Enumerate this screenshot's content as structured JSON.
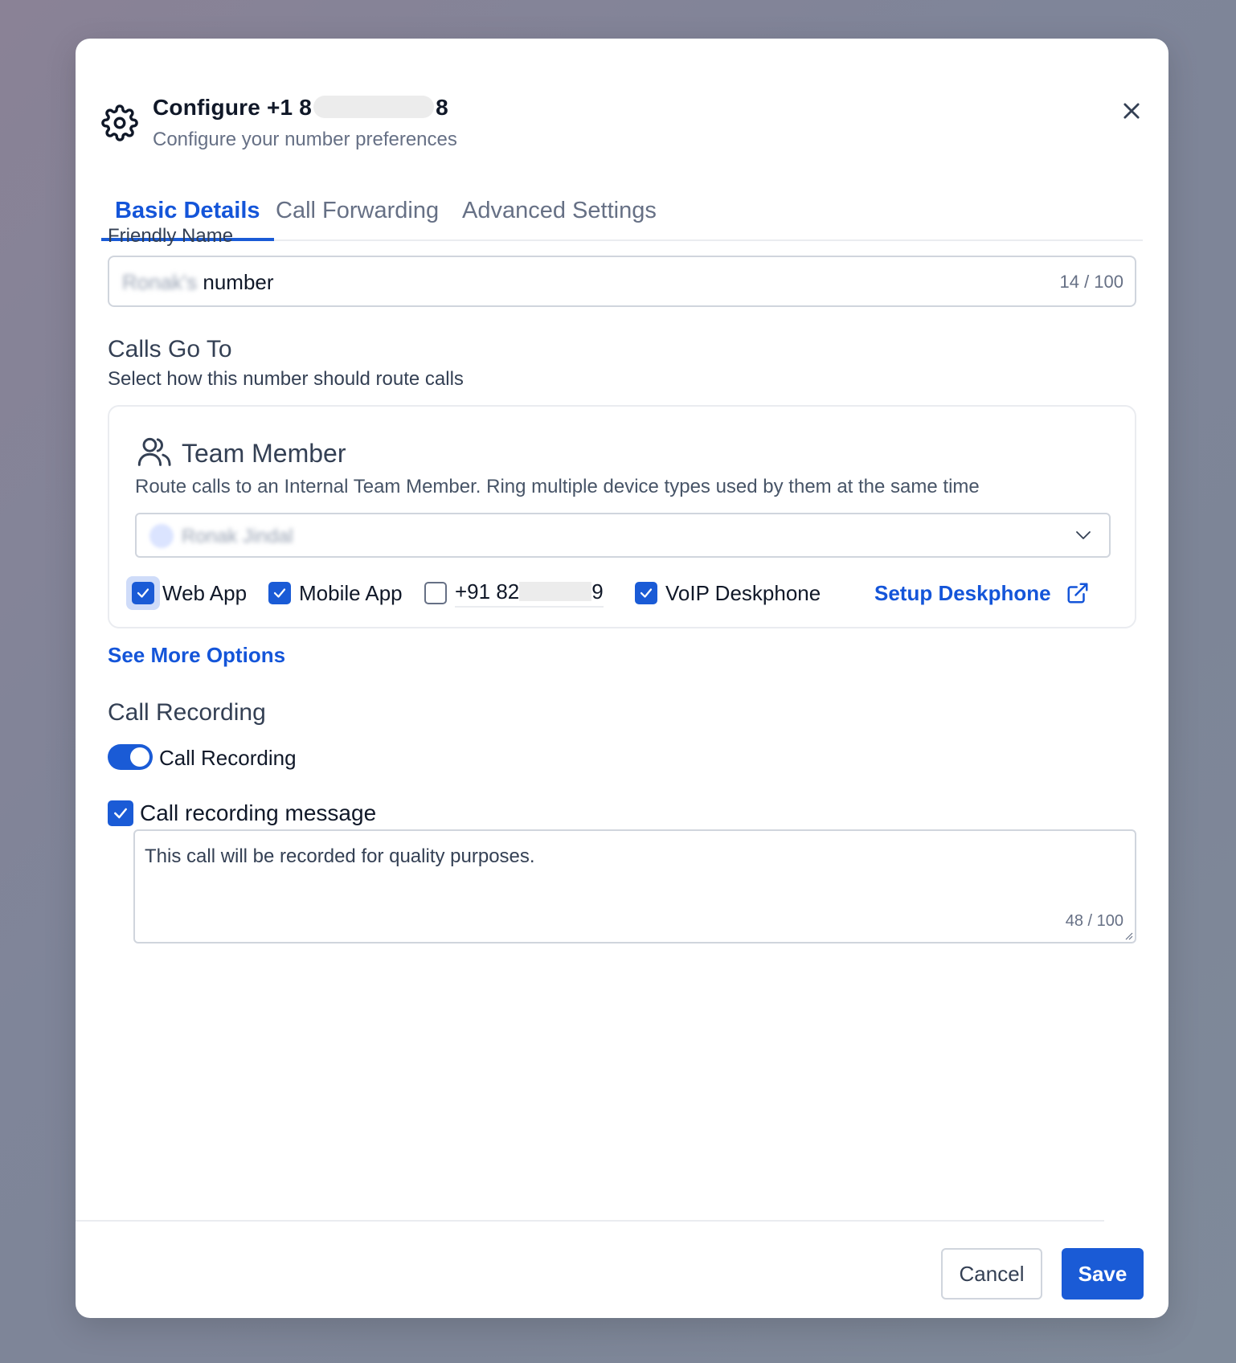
{
  "header": {
    "title_prefix": "Configure +1 8",
    "title_suffix": "8",
    "subtitle": "Configure your number preferences"
  },
  "tabs": [
    {
      "label": "Basic Details",
      "active": true
    },
    {
      "label": "Call Forwarding",
      "active": false
    },
    {
      "label": "Advanced Settings",
      "active": false
    }
  ],
  "friendly_name": {
    "label": "Friendly Name",
    "value_blurred": "Ronak's",
    "value_visible": "number",
    "counter": "14 / 100"
  },
  "calls_go_to": {
    "title": "Calls Go To",
    "subtitle": "Select how this number should route calls",
    "team_member": {
      "title": "Team Member",
      "description": "Route calls to an Internal Team Member. Ring multiple device types used by them at the same time",
      "selected_member_blurred": "Ronak Jindal",
      "options": [
        {
          "label": "Web App",
          "checked": true
        },
        {
          "label": "Mobile App",
          "checked": true
        },
        {
          "label_prefix": "+91 82",
          "label_suffix": "9",
          "checked": false
        },
        {
          "label": "VoIP Deskphone",
          "checked": true
        }
      ],
      "setup_link": "Setup Deskphone"
    }
  },
  "see_more": "See More Options",
  "call_recording": {
    "title": "Call Recording",
    "toggle_label": "Call Recording",
    "toggle_on": true,
    "message_checkbox_label": "Call recording message",
    "message_checked": true,
    "message_text": "This call will be recorded for quality purposes.",
    "message_counter": "48 / 100"
  },
  "footer": {
    "cancel": "Cancel",
    "save": "Save"
  },
  "colors": {
    "accent": "#1a5bd6",
    "link": "#1455d9"
  }
}
